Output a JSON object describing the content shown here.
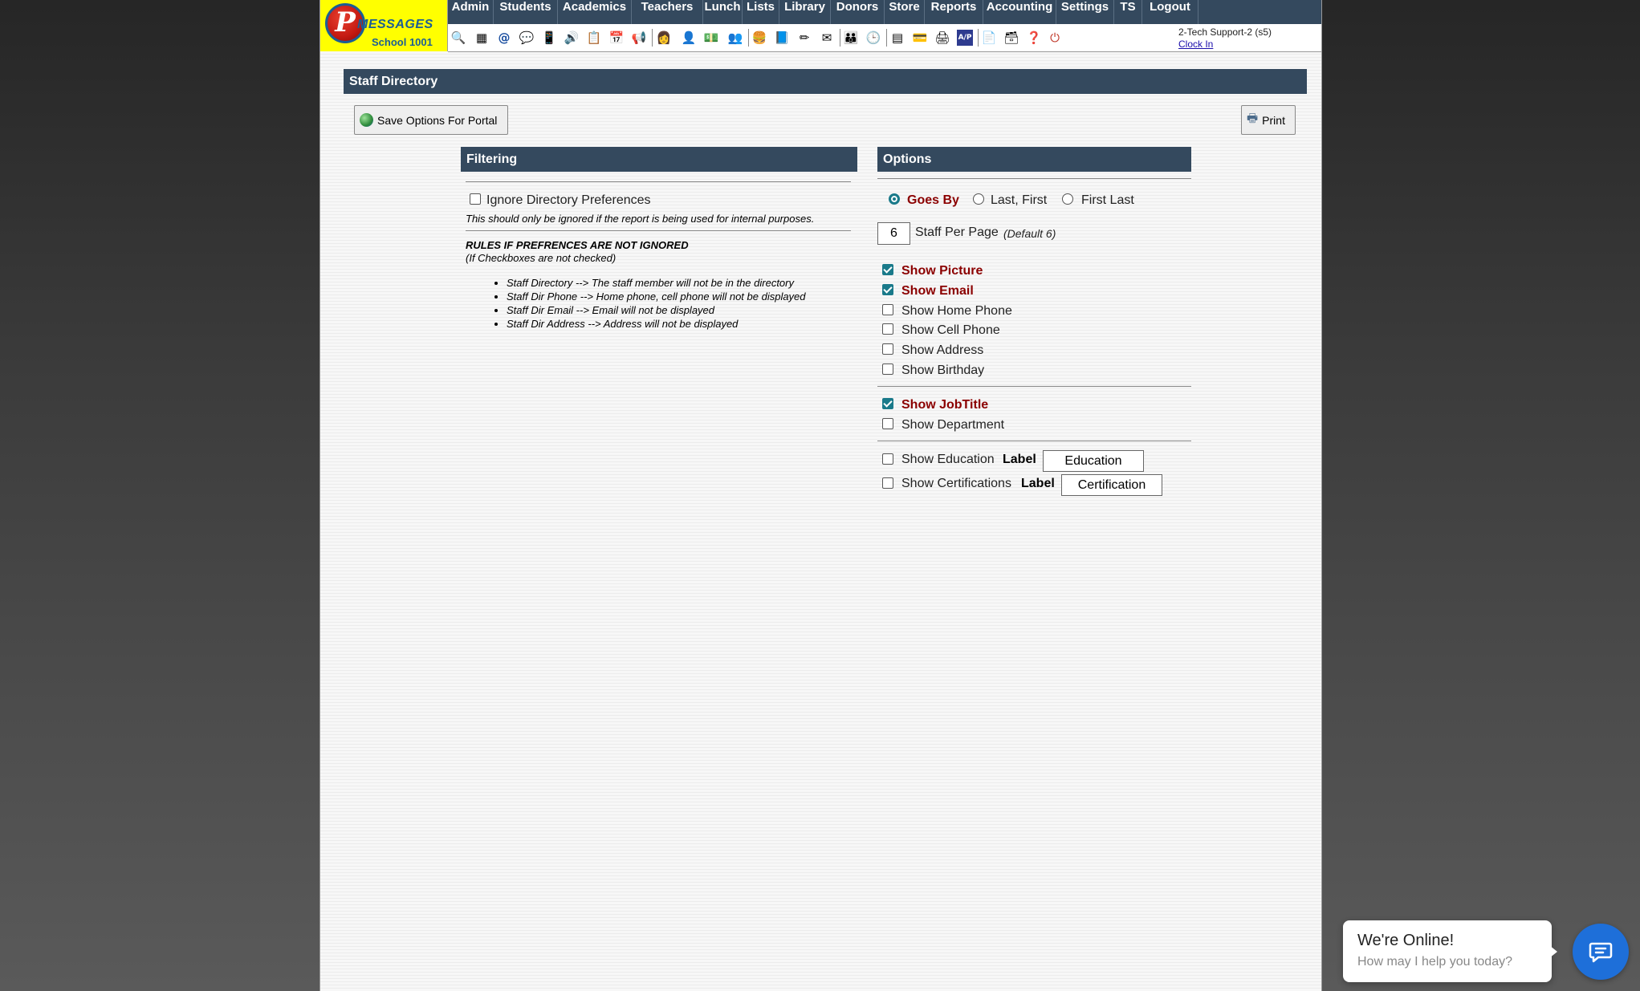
{
  "logo": {
    "brand": "MESSAGES",
    "school": "School 1001"
  },
  "menu": [
    "Admin",
    "Students",
    "Academics",
    "Teachers",
    "Lunch",
    "Lists",
    "Library",
    "Donors",
    "Store",
    "Reports",
    "Accounting",
    "Settings",
    "TS",
    "Logout"
  ],
  "user": {
    "name": "2-Tech Support-2 (s5)",
    "clock_in": "Clock In"
  },
  "page_title": "Staff Directory",
  "buttons": {
    "save": "Save Options For Portal",
    "print": "Print"
  },
  "filtering": {
    "header": "Filtering",
    "ignore_label": "Ignore Directory Preferences",
    "ignore_checked": false,
    "ignore_note": "This should only be ignored if the report is being used for internal purposes.",
    "rules_title": "RULES IF PREFRENCES ARE NOT IGNORED",
    "rules_sub": "(If Checkboxes are not checked)",
    "rules": [
      "Staff Directory --> The staff member will not be in the directory",
      "Staff Dir Phone --> Home phone, cell phone will not be displayed",
      "Staff Dir Email --> Email will not be displayed",
      "Staff Dir Address --> Address will not be displayed"
    ]
  },
  "options": {
    "header": "Options",
    "name_format": {
      "goes_by": "Goes By",
      "last_first": "Last, First",
      "first_last": "First Last",
      "selected": "Goes By"
    },
    "per_page": {
      "value": "6",
      "label": "Staff Per Page",
      "default_note": "(Default 6)"
    },
    "show_picture": "Show Picture",
    "show_email": "Show Email",
    "show_home_phone": "Show Home Phone",
    "show_cell_phone": "Show Cell Phone",
    "show_address": "Show Address",
    "show_birthday": "Show Birthday",
    "show_jobtitle": "Show JobTitle",
    "show_department": "Show Department",
    "show_education": "Show Education",
    "show_certifications": "Show Certifications",
    "label_word": "Label",
    "education_label_value": "Education",
    "certification_label_value": "Certification"
  },
  "chat": {
    "title": "We're Online!",
    "subtitle": "How may I help you today?"
  },
  "colors": {
    "header_bar": "#34495e",
    "accent_red": "#8b0000",
    "logo_yellow": "#ffff00",
    "checkbox": "#1a7a8a",
    "chat_button": "#1e6fd9"
  }
}
